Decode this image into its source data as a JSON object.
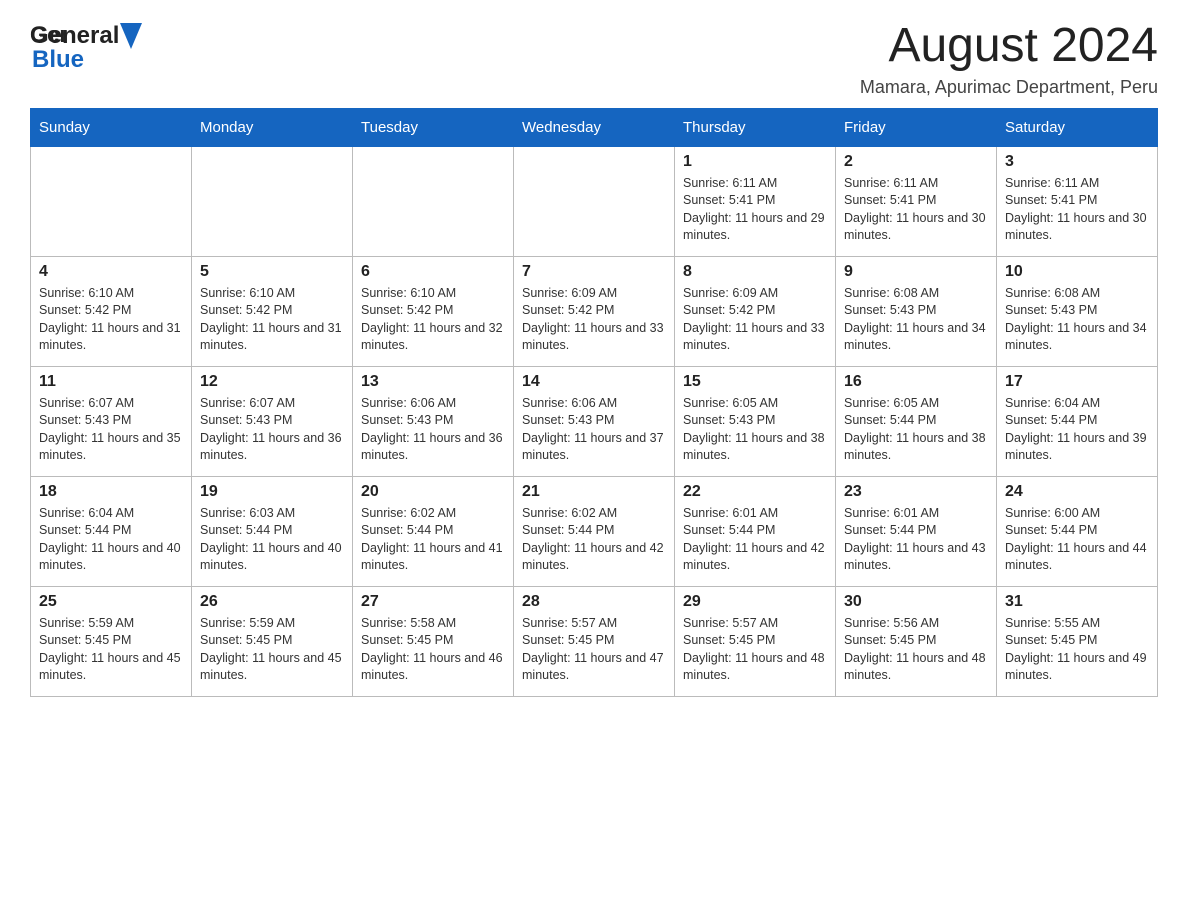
{
  "header": {
    "logo_general": "General",
    "logo_blue": "Blue",
    "month_title": "August 2024",
    "location": "Mamara, Apurimac Department, Peru"
  },
  "days_of_week": [
    "Sunday",
    "Monday",
    "Tuesday",
    "Wednesday",
    "Thursday",
    "Friday",
    "Saturday"
  ],
  "weeks": [
    [
      {
        "day": "",
        "sunrise": "",
        "sunset": "",
        "daylight": ""
      },
      {
        "day": "",
        "sunrise": "",
        "sunset": "",
        "daylight": ""
      },
      {
        "day": "",
        "sunrise": "",
        "sunset": "",
        "daylight": ""
      },
      {
        "day": "",
        "sunrise": "",
        "sunset": "",
        "daylight": ""
      },
      {
        "day": "1",
        "sunrise": "Sunrise: 6:11 AM",
        "sunset": "Sunset: 5:41 PM",
        "daylight": "Daylight: 11 hours and 29 minutes."
      },
      {
        "day": "2",
        "sunrise": "Sunrise: 6:11 AM",
        "sunset": "Sunset: 5:41 PM",
        "daylight": "Daylight: 11 hours and 30 minutes."
      },
      {
        "day": "3",
        "sunrise": "Sunrise: 6:11 AM",
        "sunset": "Sunset: 5:41 PM",
        "daylight": "Daylight: 11 hours and 30 minutes."
      }
    ],
    [
      {
        "day": "4",
        "sunrise": "Sunrise: 6:10 AM",
        "sunset": "Sunset: 5:42 PM",
        "daylight": "Daylight: 11 hours and 31 minutes."
      },
      {
        "day": "5",
        "sunrise": "Sunrise: 6:10 AM",
        "sunset": "Sunset: 5:42 PM",
        "daylight": "Daylight: 11 hours and 31 minutes."
      },
      {
        "day": "6",
        "sunrise": "Sunrise: 6:10 AM",
        "sunset": "Sunset: 5:42 PM",
        "daylight": "Daylight: 11 hours and 32 minutes."
      },
      {
        "day": "7",
        "sunrise": "Sunrise: 6:09 AM",
        "sunset": "Sunset: 5:42 PM",
        "daylight": "Daylight: 11 hours and 33 minutes."
      },
      {
        "day": "8",
        "sunrise": "Sunrise: 6:09 AM",
        "sunset": "Sunset: 5:42 PM",
        "daylight": "Daylight: 11 hours and 33 minutes."
      },
      {
        "day": "9",
        "sunrise": "Sunrise: 6:08 AM",
        "sunset": "Sunset: 5:43 PM",
        "daylight": "Daylight: 11 hours and 34 minutes."
      },
      {
        "day": "10",
        "sunrise": "Sunrise: 6:08 AM",
        "sunset": "Sunset: 5:43 PM",
        "daylight": "Daylight: 11 hours and 34 minutes."
      }
    ],
    [
      {
        "day": "11",
        "sunrise": "Sunrise: 6:07 AM",
        "sunset": "Sunset: 5:43 PM",
        "daylight": "Daylight: 11 hours and 35 minutes."
      },
      {
        "day": "12",
        "sunrise": "Sunrise: 6:07 AM",
        "sunset": "Sunset: 5:43 PM",
        "daylight": "Daylight: 11 hours and 36 minutes."
      },
      {
        "day": "13",
        "sunrise": "Sunrise: 6:06 AM",
        "sunset": "Sunset: 5:43 PM",
        "daylight": "Daylight: 11 hours and 36 minutes."
      },
      {
        "day": "14",
        "sunrise": "Sunrise: 6:06 AM",
        "sunset": "Sunset: 5:43 PM",
        "daylight": "Daylight: 11 hours and 37 minutes."
      },
      {
        "day": "15",
        "sunrise": "Sunrise: 6:05 AM",
        "sunset": "Sunset: 5:43 PM",
        "daylight": "Daylight: 11 hours and 38 minutes."
      },
      {
        "day": "16",
        "sunrise": "Sunrise: 6:05 AM",
        "sunset": "Sunset: 5:44 PM",
        "daylight": "Daylight: 11 hours and 38 minutes."
      },
      {
        "day": "17",
        "sunrise": "Sunrise: 6:04 AM",
        "sunset": "Sunset: 5:44 PM",
        "daylight": "Daylight: 11 hours and 39 minutes."
      }
    ],
    [
      {
        "day": "18",
        "sunrise": "Sunrise: 6:04 AM",
        "sunset": "Sunset: 5:44 PM",
        "daylight": "Daylight: 11 hours and 40 minutes."
      },
      {
        "day": "19",
        "sunrise": "Sunrise: 6:03 AM",
        "sunset": "Sunset: 5:44 PM",
        "daylight": "Daylight: 11 hours and 40 minutes."
      },
      {
        "day": "20",
        "sunrise": "Sunrise: 6:02 AM",
        "sunset": "Sunset: 5:44 PM",
        "daylight": "Daylight: 11 hours and 41 minutes."
      },
      {
        "day": "21",
        "sunrise": "Sunrise: 6:02 AM",
        "sunset": "Sunset: 5:44 PM",
        "daylight": "Daylight: 11 hours and 42 minutes."
      },
      {
        "day": "22",
        "sunrise": "Sunrise: 6:01 AM",
        "sunset": "Sunset: 5:44 PM",
        "daylight": "Daylight: 11 hours and 42 minutes."
      },
      {
        "day": "23",
        "sunrise": "Sunrise: 6:01 AM",
        "sunset": "Sunset: 5:44 PM",
        "daylight": "Daylight: 11 hours and 43 minutes."
      },
      {
        "day": "24",
        "sunrise": "Sunrise: 6:00 AM",
        "sunset": "Sunset: 5:44 PM",
        "daylight": "Daylight: 11 hours and 44 minutes."
      }
    ],
    [
      {
        "day": "25",
        "sunrise": "Sunrise: 5:59 AM",
        "sunset": "Sunset: 5:45 PM",
        "daylight": "Daylight: 11 hours and 45 minutes."
      },
      {
        "day": "26",
        "sunrise": "Sunrise: 5:59 AM",
        "sunset": "Sunset: 5:45 PM",
        "daylight": "Daylight: 11 hours and 45 minutes."
      },
      {
        "day": "27",
        "sunrise": "Sunrise: 5:58 AM",
        "sunset": "Sunset: 5:45 PM",
        "daylight": "Daylight: 11 hours and 46 minutes."
      },
      {
        "day": "28",
        "sunrise": "Sunrise: 5:57 AM",
        "sunset": "Sunset: 5:45 PM",
        "daylight": "Daylight: 11 hours and 47 minutes."
      },
      {
        "day": "29",
        "sunrise": "Sunrise: 5:57 AM",
        "sunset": "Sunset: 5:45 PM",
        "daylight": "Daylight: 11 hours and 48 minutes."
      },
      {
        "day": "30",
        "sunrise": "Sunrise: 5:56 AM",
        "sunset": "Sunset: 5:45 PM",
        "daylight": "Daylight: 11 hours and 48 minutes."
      },
      {
        "day": "31",
        "sunrise": "Sunrise: 5:55 AM",
        "sunset": "Sunset: 5:45 PM",
        "daylight": "Daylight: 11 hours and 49 minutes."
      }
    ]
  ]
}
